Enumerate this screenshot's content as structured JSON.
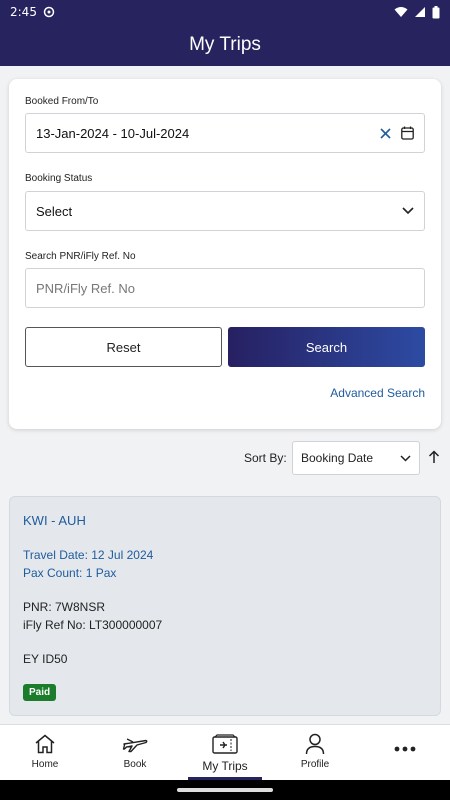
{
  "status_bar": {
    "time": "2:45"
  },
  "app_bar": {
    "title": "My Trips"
  },
  "filter": {
    "booked_label": "Booked From/To",
    "booked_value": "13-Jan-2024 - 10-Jul-2024",
    "status_label": "Booking Status",
    "status_value": "Select",
    "pnr_label": "Search PNR/iFly Ref. No",
    "pnr_placeholder": "PNR/iFly Ref. No",
    "reset_label": "Reset",
    "search_label": "Search",
    "advanced_label": "Advanced Search"
  },
  "sort": {
    "label": "Sort By:",
    "value": "Booking Date"
  },
  "trips": [
    {
      "route": "KWI - AUH",
      "travel_date": "Travel Date: 12 Jul 2024",
      "pax_count": "Pax Count: 1 Pax",
      "pnr": "PNR: 7W8NSR",
      "ifly_ref": "iFly Ref No: LT300000007",
      "flight": "EY ID50",
      "status": "Paid"
    }
  ],
  "bottom_nav": {
    "items": [
      {
        "label": "Home",
        "icon": "home-icon"
      },
      {
        "label": "Book",
        "icon": "plane-icon"
      },
      {
        "label": "My Trips",
        "icon": "ticket-icon",
        "active": true
      },
      {
        "label": "Profile",
        "icon": "person-icon"
      },
      {
        "label": "",
        "icon": "more-icon"
      }
    ]
  },
  "colors": {
    "primary": "#26235f",
    "accent": "#1f5b9d",
    "paid": "#1b7d2b"
  }
}
